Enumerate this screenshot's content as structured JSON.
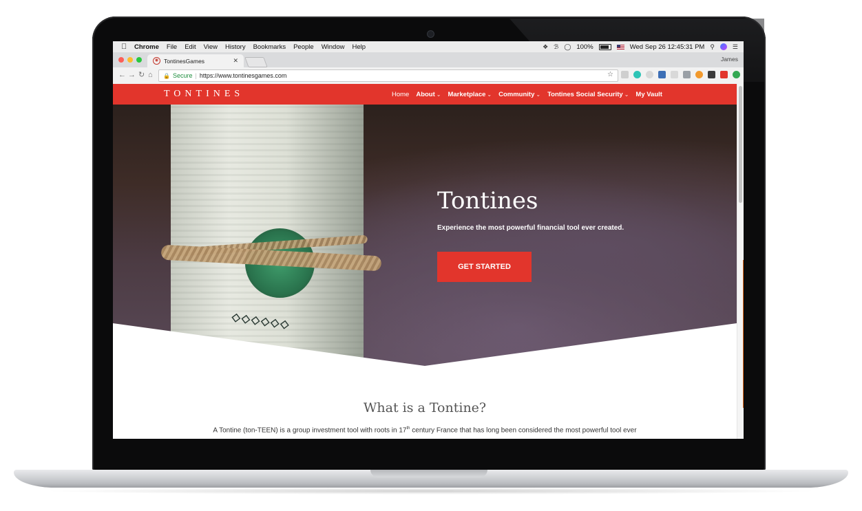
{
  "mac_menubar": {
    "app_name": "Chrome",
    "menus": [
      "File",
      "Edit",
      "View",
      "History",
      "Bookmarks",
      "People",
      "Window",
      "Help"
    ],
    "battery": "100%",
    "clock": "Wed Sep 26  12:45:31 PM"
  },
  "browser": {
    "tab_title": "TontinesGames",
    "profile_name": "James",
    "secure_label": "Secure",
    "url": "https://www.tontinesgames.com"
  },
  "site": {
    "logo": "TONTINES",
    "nav": [
      {
        "label": "Home"
      },
      {
        "label": "About"
      },
      {
        "label": "Marketplace"
      },
      {
        "label": "Community"
      },
      {
        "label": "Tontines Social Security"
      },
      {
        "label": "My Vault"
      }
    ],
    "hero": {
      "title": "Tontines",
      "subtitle": "Experience the most powerful financial tool ever created.",
      "cta_label": "GET STARTED"
    },
    "section": {
      "title": "What is a Tontine?",
      "body_pre": "A Tontine (ton-TEEN) is a group investment tool with roots in 17",
      "body_sup": "th",
      "body_post": " century France that has long been considered the most powerful tool ever"
    }
  },
  "colors": {
    "brand_red": "#e2352c",
    "secure_green": "#1e8e3e"
  }
}
